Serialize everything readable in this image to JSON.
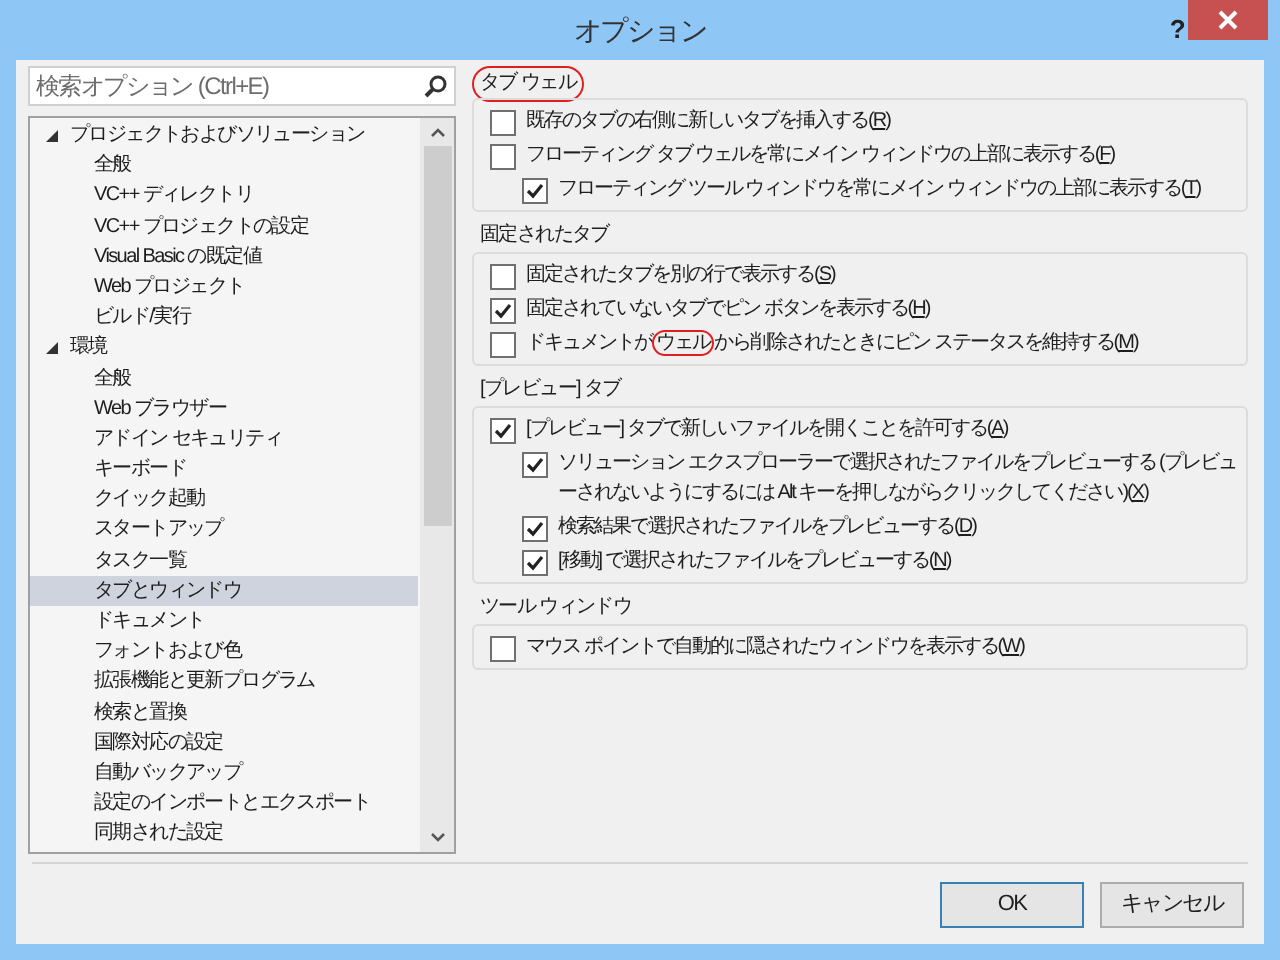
{
  "window": {
    "title": "オプション",
    "help": "?"
  },
  "search": {
    "placeholder": "検索オプション (Ctrl+E)"
  },
  "tree": [
    {
      "label": "プロジェクトおよびソリューション",
      "expanded": true,
      "selected": false,
      "children": [
        {
          "label": "全般",
          "selected": false
        },
        {
          "label": "VC++ ディレクトリ",
          "selected": false
        },
        {
          "label": "VC++ プロジェクトの設定",
          "selected": false
        },
        {
          "label": "Visual Basic の既定値",
          "selected": false
        },
        {
          "label": "Web プロジェクト",
          "selected": false
        },
        {
          "label": "ビルド/実行",
          "selected": false
        }
      ]
    },
    {
      "label": "環境",
      "expanded": true,
      "selected": false,
      "children": [
        {
          "label": "全般",
          "selected": false
        },
        {
          "label": "Web ブラウザー",
          "selected": false
        },
        {
          "label": "アドイン セキュリティ",
          "selected": false
        },
        {
          "label": "キーボード",
          "selected": false
        },
        {
          "label": "クイック起動",
          "selected": false
        },
        {
          "label": "スタートアップ",
          "selected": false
        },
        {
          "label": "タスク一覧",
          "selected": false
        },
        {
          "label": "タブとウィンドウ",
          "selected": true
        },
        {
          "label": "ドキュメント",
          "selected": false
        },
        {
          "label": "フォントおよび色",
          "selected": false
        },
        {
          "label": "拡張機能と更新プログラム",
          "selected": false
        },
        {
          "label": "検索と置換",
          "selected": false
        },
        {
          "label": "国際対応の設定",
          "selected": false
        },
        {
          "label": "自動バックアップ",
          "selected": false
        },
        {
          "label": "設定のインポートとエクスポート",
          "selected": false
        },
        {
          "label": "同期された設定",
          "selected": false
        }
      ]
    }
  ],
  "groups": [
    {
      "title": "タブ ウェル",
      "circled": true,
      "options": [
        {
          "parts": [
            {
              "text": "既存のタブの右側に新しいタブを挿入する(R)",
              "circled": false
            }
          ],
          "checked": false,
          "indent": false
        },
        {
          "parts": [
            {
              "text": "フローティング タブ ウェルを常にメイン ウィンドウの上部に表示する(F)",
              "circled": false
            }
          ],
          "checked": false,
          "indent": false
        },
        {
          "parts": [
            {
              "text": "フローティング ツール ウィンドウを常にメイン ウィンドウの上部に表示する(T)",
              "circled": false
            }
          ],
          "checked": true,
          "indent": true
        }
      ]
    },
    {
      "title": "固定されたタブ",
      "circled": false,
      "options": [
        {
          "parts": [
            {
              "text": "固定されたタブを別の行で表示する(S)",
              "circled": false
            }
          ],
          "checked": false,
          "indent": false
        },
        {
          "parts": [
            {
              "text": "固定されていないタブでピン ボタンを表示する(H)",
              "circled": false
            }
          ],
          "checked": true,
          "indent": false
        },
        {
          "parts": [
            {
              "text": "ドキュメントが",
              "circled": false
            },
            {
              "text": "ウェル",
              "circled": true
            },
            {
              "text": "から削除されたときにピン ステータスを維持する(M)",
              "circled": false
            }
          ],
          "checked": false,
          "indent": false
        }
      ]
    },
    {
      "title": "[プレビュー] タブ",
      "circled": false,
      "options": [
        {
          "parts": [
            {
              "text": "[プレビュー] タブで新しいファイルを開くことを許可する(A)",
              "circled": false
            }
          ],
          "checked": true,
          "indent": false
        },
        {
          "parts": [
            {
              "text": "ソリューション エクスプローラーで選択されたファイルをプレビューする (プレビューされないようにするには Alt キーを押しながらクリックしてください)(X)",
              "circled": false
            }
          ],
          "checked": true,
          "indent": true
        },
        {
          "parts": [
            {
              "text": "検索結果で選択されたファイルをプレビューする(D)",
              "circled": false
            }
          ],
          "checked": true,
          "indent": true
        },
        {
          "parts": [
            {
              "text": "[移動] で選択されたファイルをプレビューする(N)",
              "circled": false
            }
          ],
          "checked": true,
          "indent": true
        }
      ]
    },
    {
      "title": "ツール ウィンドウ",
      "circled": false,
      "options": [
        {
          "parts": [
            {
              "text": "マウス ポイントで自動的に隠されたウィンドウを表示する(W)",
              "circled": false
            }
          ],
          "checked": false,
          "indent": false
        }
      ]
    }
  ],
  "buttons": [
    {
      "label": "OK",
      "default": true
    },
    {
      "label": "キャンセル",
      "default": false
    }
  ]
}
